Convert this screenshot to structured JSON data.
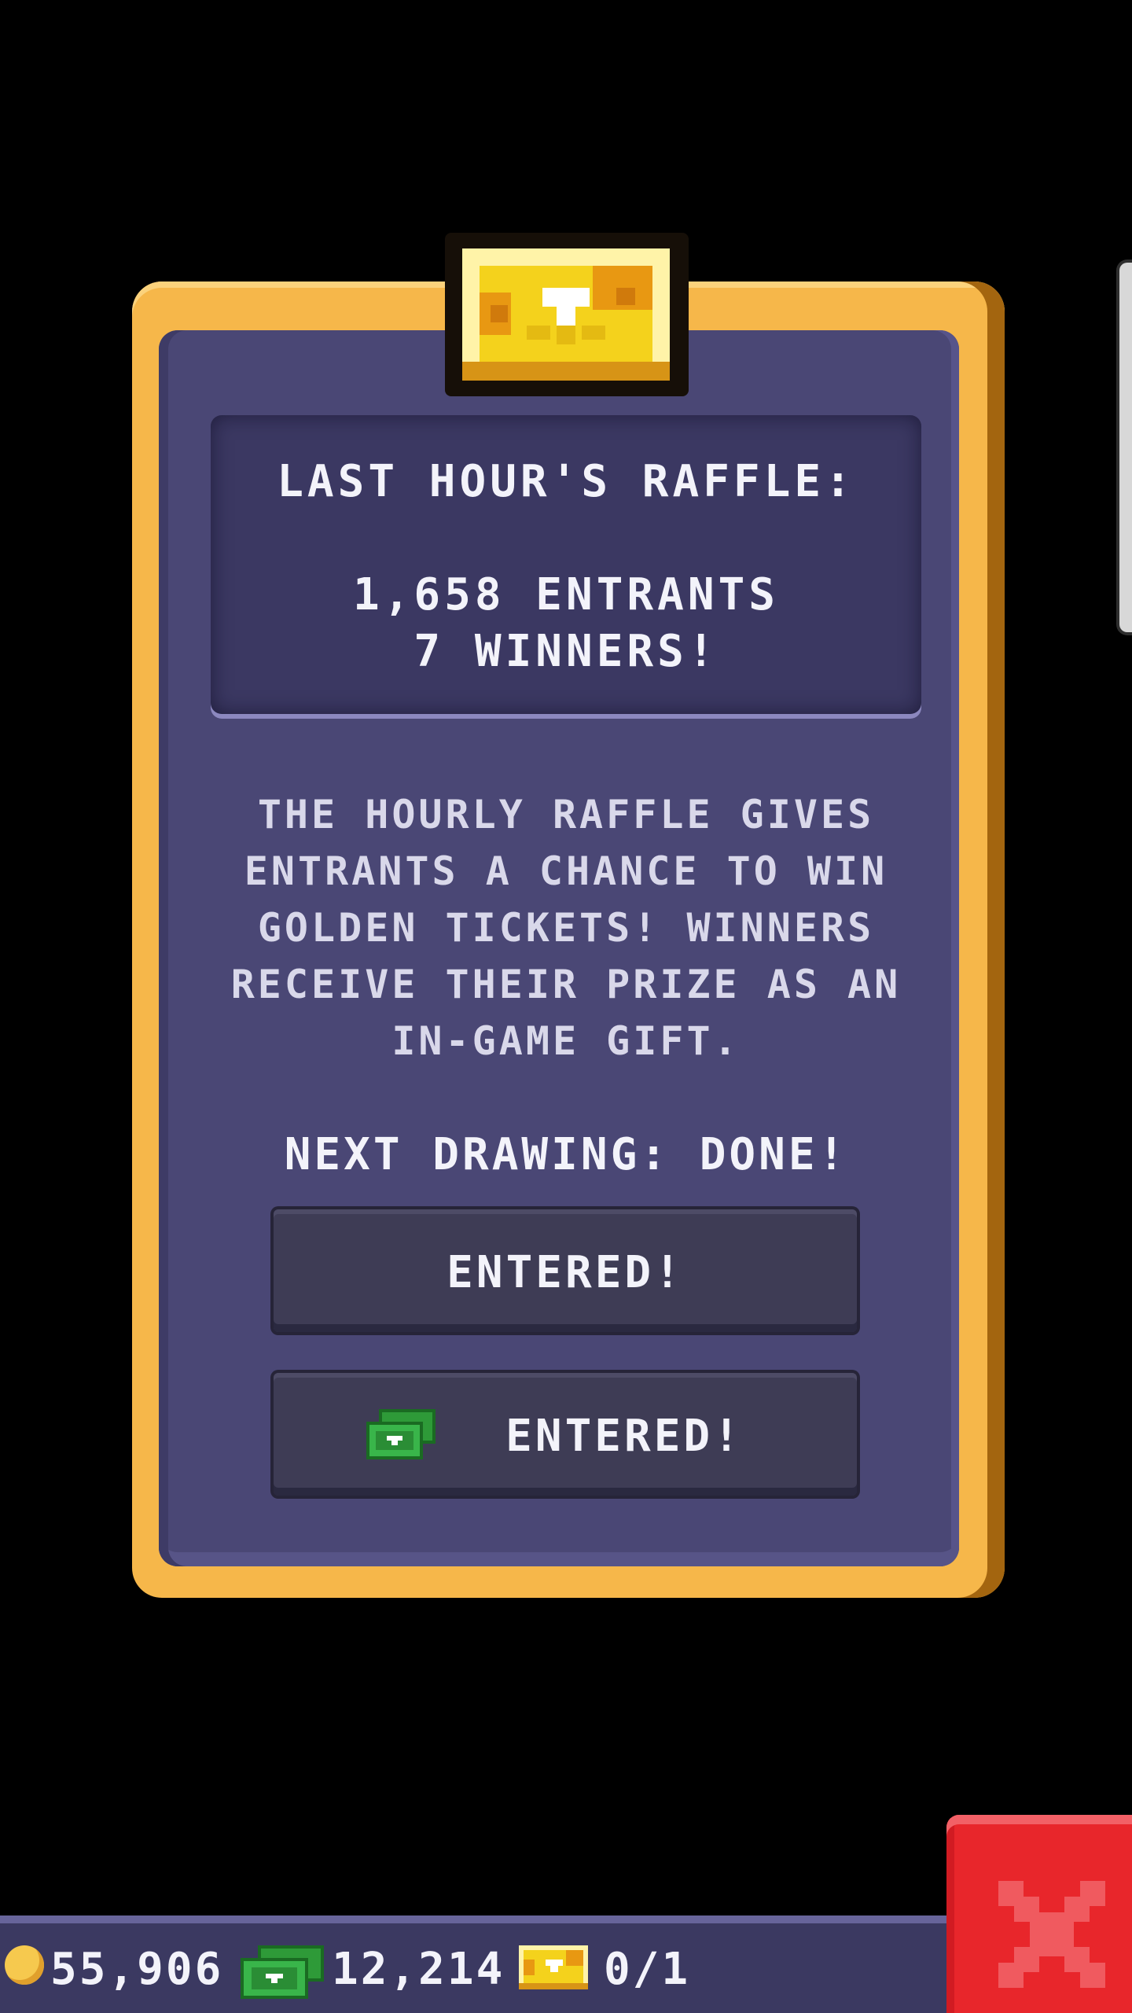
{
  "raffle": {
    "header_title": "LAST HOUR'S RAFFLE:",
    "entrants": "1,658 ENTRANTS",
    "winners": "7 WINNERS!",
    "description_lines": [
      "THE HOURLY RAFFLE GIVES",
      "ENTRANTS A CHANCE TO WIN",
      "GOLDEN TICKETS! WINNERS",
      "RECEIVE THEIR PRIZE AS AN",
      "IN-GAME GIFT."
    ],
    "next_drawing": "NEXT DRAWING: DONE!",
    "button_free_label": "ENTERED!",
    "button_cash_label": "ENTERED!"
  },
  "currency": {
    "coins": "55,906",
    "bux": "12,214",
    "golden_tickets": "0/1"
  },
  "icons": {
    "badge": "golden-ticket-icon",
    "button_cash": "tower-bux-icon",
    "bar_coin": "coin-icon",
    "bar_bux": "tower-bux-icon",
    "bar_ticket": "golden-ticket-icon",
    "close": "close-icon"
  },
  "colors": {
    "card_frame": "#f6b74a",
    "card_body": "#4a4775",
    "close_button": "#e8262b",
    "bux_green": "#2fa33a"
  }
}
